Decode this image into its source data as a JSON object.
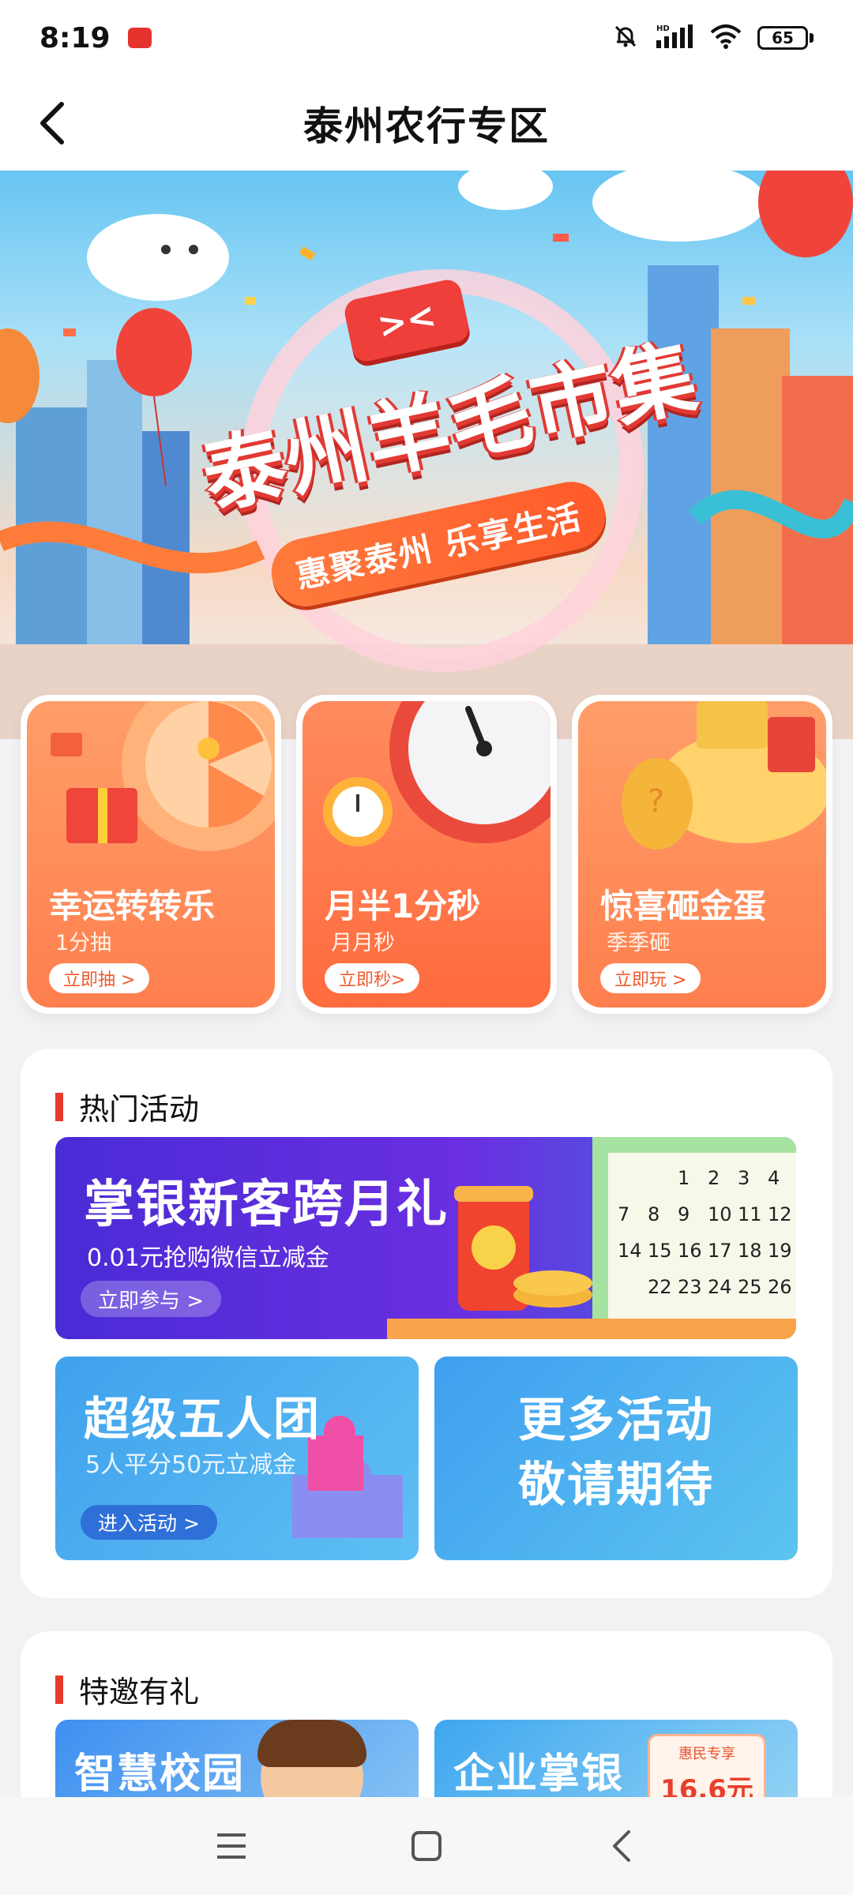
{
  "status_bar": {
    "time": "8:19",
    "hd_label": "HD",
    "battery": "65",
    "icons": [
      "notification-app-icon",
      "mute-bell-icon",
      "signal-icon",
      "wifi-icon",
      "battery-icon"
    ]
  },
  "nav": {
    "title": "泰州农行专区",
    "back_icon": "chevron-left-icon"
  },
  "hero": {
    "badge": "&gt;&lt;",
    "title": "泰州羊毛市集",
    "subtitle": "惠聚泰州 乐享生活"
  },
  "games": [
    {
      "title": "幸运转转乐",
      "subtitle": "1分抽",
      "button": "立即抽 >"
    },
    {
      "title": "月半1分秒",
      "subtitle": "月月秒",
      "button": "立即秒>"
    },
    {
      "title": "惊喜砸金蛋",
      "subtitle": "季季砸",
      "button": "立即玩 >"
    }
  ],
  "hot_section": {
    "title": "热门活动",
    "main_banner": {
      "title": "掌银新客跨月礼",
      "subtitle": "0.01元抢购微信立减金",
      "button": "立即参与 >",
      "calendar_days": [
        "1",
        "2",
        "3",
        "4",
        "7",
        "8",
        "9",
        "10",
        "11",
        "12",
        "14",
        "15",
        "16",
        "17",
        "18",
        "19",
        "22",
        "23",
        "24",
        "25",
        "26"
      ]
    },
    "left_banner": {
      "title": "超级五人团",
      "subtitle": "5人平分50元立减金",
      "button": "进入活动 >"
    },
    "right_banner": {
      "line1": "更多活动",
      "line2": "敬请期待"
    }
  },
  "invite_section": {
    "title": "特邀有礼",
    "left_card": {
      "title": "智慧校园"
    },
    "right_card": {
      "title": "企业掌银",
      "coupon_tag": "惠民专享",
      "coupon_value": "16.6元"
    }
  },
  "bottom_nav": {
    "icons": [
      "menu-icon",
      "home-square-icon",
      "back-triangle-icon"
    ]
  },
  "colors": {
    "accent_red": "#e83a2a",
    "orange": "#ff7f4e",
    "purple": "#4a2bd6",
    "blue": "#3fa1ec"
  }
}
